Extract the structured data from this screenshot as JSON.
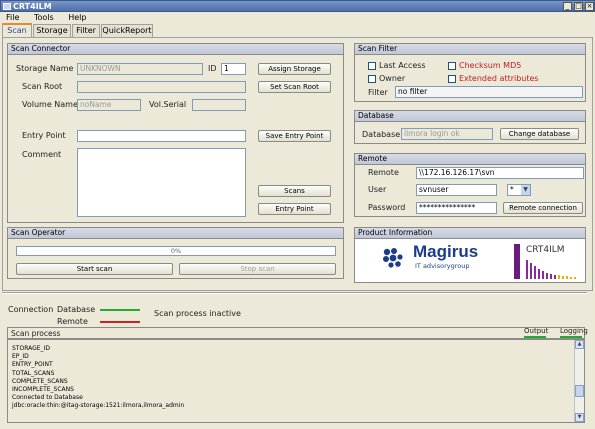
{
  "window": {
    "title": "CRT4ILM",
    "min": "_",
    "max": "□",
    "close": "×"
  },
  "menu": [
    "File",
    "Tools",
    "Help"
  ],
  "tabs": [
    "Scan",
    "Storage",
    "Filter",
    "QuickReport"
  ],
  "scan_connector": {
    "header": "Scan Connector",
    "storage_name_label": "Storage Name",
    "storage_name_value": "UNKNOWN",
    "id_label": "ID",
    "id_value": "1",
    "assign_storage": "Assign Storage",
    "scan_root_label": "Scan Root",
    "scan_root_value": "",
    "set_scan_root": "Set Scan Root",
    "volume_name_label": "Volume Name",
    "volume_name_placeholder": "noName",
    "volume_serial_label": "Vol.Serial",
    "entry_point_label": "Entry Point",
    "entry_point_value": "",
    "save_entry_point": "Save Entry Point",
    "comment_label": "Comment",
    "comment_value": "",
    "scans_button": "Scans",
    "entry_point_button": "Entry Point"
  },
  "scan_operator": {
    "header": "Scan Operator",
    "progress_text": "0%",
    "progress": 0,
    "start_scan": "Start scan",
    "stop_scan": "Stop scan"
  },
  "scan_filter": {
    "header": "Scan Filter",
    "last_access": "Last Access",
    "owner": "Owner",
    "checksum_md5": "Checksum MD5",
    "extended_attributes": "Extended attributes",
    "filter_label": "Filter",
    "filter_value": "no filter"
  },
  "database": {
    "header": "Database",
    "label": "Database",
    "value": "ilmora login ok",
    "change": "Change database"
  },
  "remote": {
    "header": "Remote",
    "remote_label": "Remote",
    "remote_value": "\\\\172.16.126.17\\svn",
    "user_label": "User",
    "user_value": "svnuser",
    "user_select": "*",
    "password_label": "Password",
    "password_value": "***************",
    "connect": "Remote connection"
  },
  "product": {
    "header": "Product Information",
    "brand": "Magirus",
    "brand_sub": "IT advisorygroup",
    "product_name": "CRT4ILM"
  },
  "status": {
    "connection_label": "Connection",
    "database_label": "Database",
    "remote_label": "Remote",
    "scan_process_text": "Scan process  inactive",
    "database_color": "#22aa33",
    "remote_color": "#cc2222"
  },
  "scan_process": {
    "header": "Scan process",
    "output_label": "Output",
    "logging_label": "Logging",
    "lines": "STORAGE_ID\nEP_ID\nENTRY_POINT\nTOTAL_SCANS\nCOMPLETE_SCANS\nINCOMPLETE_SCANS\nConnected to Database\njdbc:oracle:thin:@itag-storage:1521:ilmora,ilmora_admin"
  },
  "colors": {
    "accent_tab": "#e68a2e",
    "warn_text": "#c02020",
    "status_green": "#22aa33",
    "status_red": "#cc2222"
  }
}
